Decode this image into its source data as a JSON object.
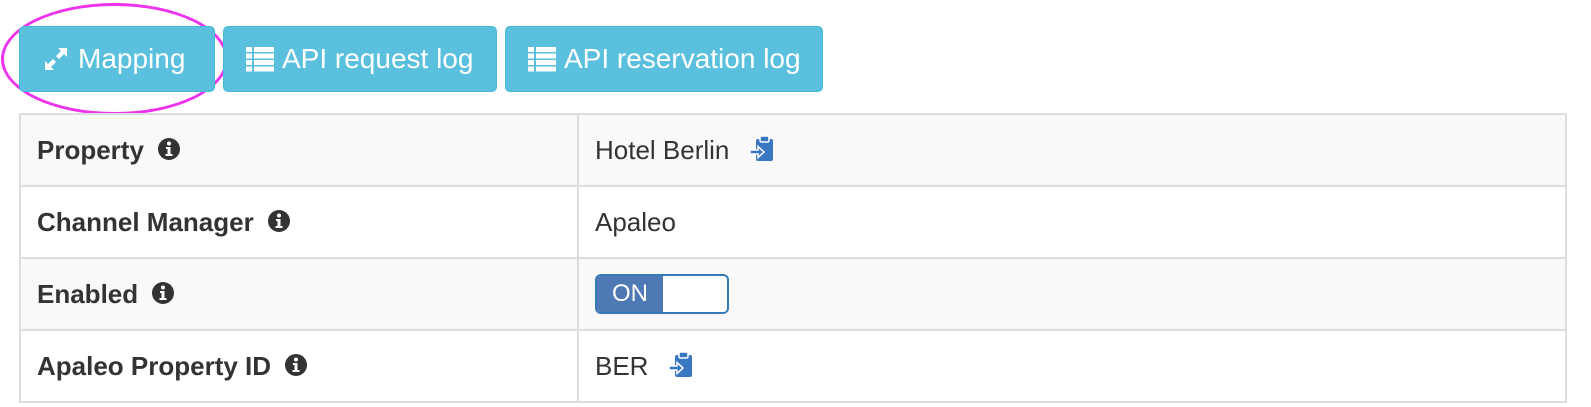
{
  "toolbar": {
    "mapping_label": "Mapping",
    "mapping_icon": "expand-arrows-icon",
    "request_log_label": "API request log",
    "request_log_icon": "list-icon",
    "reservation_log_label": "API reservation log",
    "reservation_log_icon": "list-icon",
    "button_color": "#5bc0de",
    "highlight_color": "#ee33ee"
  },
  "details": {
    "rows": [
      {
        "label": "Property",
        "value": "Hotel Berlin",
        "info_icon": "info-circle-icon",
        "copy_icon": "clipboard-copy-icon"
      },
      {
        "label": "Channel Manager",
        "value": "Apaleo",
        "info_icon": "info-circle-icon"
      },
      {
        "label": "Enabled",
        "toggle_label": "ON",
        "toggle_state": true,
        "info_icon": "info-circle-icon"
      },
      {
        "label": "Apaleo Property ID",
        "value": "BER",
        "info_icon": "info-circle-icon",
        "copy_icon": "clipboard-copy-icon"
      }
    ],
    "toggle_color": "#4f79b4"
  }
}
